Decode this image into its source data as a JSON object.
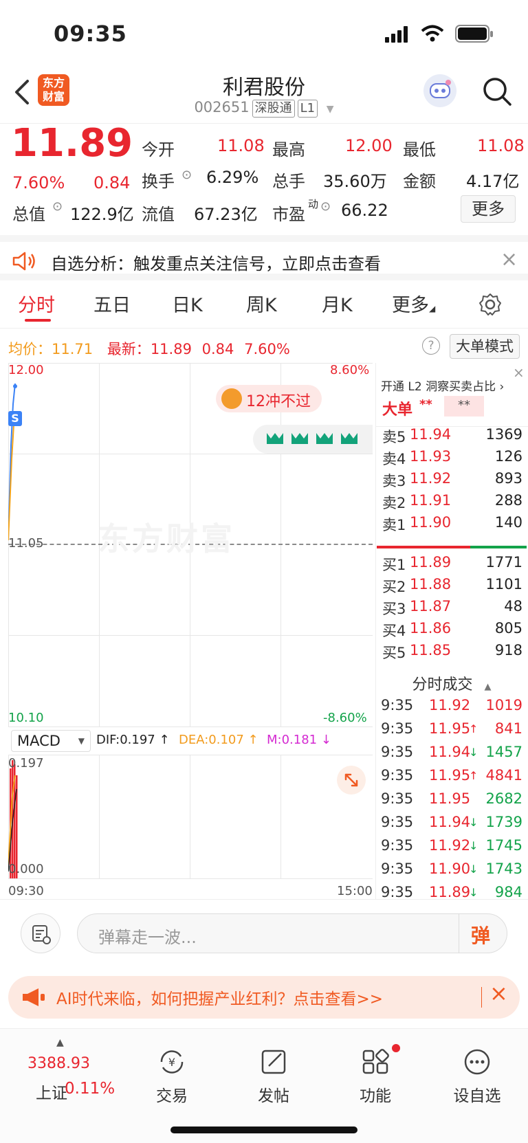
{
  "status_bar": {
    "time": "09:35"
  },
  "header": {
    "back_label": "<",
    "logo_text": "东方财富",
    "stock_name": "利君股份",
    "stock_code": "002651",
    "tag_market": "深股通",
    "tag_level": "L1"
  },
  "quote": {
    "price": "11.89",
    "change_pct": "7.60%",
    "change_abs": "0.84",
    "open_label": "今开",
    "open_value": "11.08",
    "high_label": "最高",
    "high_value": "12.00",
    "low_label": "最低",
    "low_value": "11.08",
    "turnover_label": "换手",
    "turnover_value": "6.29%",
    "volume_label": "总手",
    "volume_value": "35.60万",
    "amount_label": "金额",
    "amount_value": "4.17亿",
    "mktcap_label": "总值",
    "mktcap_value": "122.9亿",
    "float_label": "流值",
    "float_value": "67.23亿",
    "pe_label": "市盈",
    "pe_sup": "动",
    "pe_value": "66.22",
    "more_label": "更多"
  },
  "signal": {
    "text": "自选分析：触发重点关注信号，立即点击查看",
    "close": "×"
  },
  "tabs": [
    "分时",
    "五日",
    "日K",
    "周K",
    "月K",
    "更多"
  ],
  "price_line": {
    "avg_label": "均价：",
    "avg_value": "11.71",
    "latest_label": "最新：",
    "latest_value": "11.89",
    "latest_change": "0.84",
    "latest_pct": "7.60%",
    "help": "?",
    "mode_button": "大单模式"
  },
  "chart": {
    "y_top": "12.00",
    "y_top_pct": "8.60%",
    "y_mid": "11.05",
    "y_bottom": "10.10",
    "y_bottom_pct": "-8.60%",
    "badge_text": "12冲不过",
    "watermark": "东方财富",
    "s_marker": "S",
    "x_start": "09:30",
    "x_end": "15:00"
  },
  "macd": {
    "selector": "MACD",
    "dif_label": "DIF:0.197 ↑",
    "dea_label": "DEA:0.107 ↑",
    "m_label": "M:0.181 ↓",
    "y_top": "0.197",
    "y_bottom": "0.000"
  },
  "order_book": {
    "promo": "开通 L2 洞察买卖占比 ›",
    "big_label": "大单",
    "big_value": "**",
    "big_value2": "**",
    "asks": [
      {
        "label": "卖5",
        "price": "11.94",
        "vol": "1369"
      },
      {
        "label": "卖4",
        "price": "11.93",
        "vol": "126"
      },
      {
        "label": "卖3",
        "price": "11.92",
        "vol": "893"
      },
      {
        "label": "卖2",
        "price": "11.91",
        "vol": "288"
      },
      {
        "label": "卖1",
        "price": "11.90",
        "vol": "140"
      }
    ],
    "bids": [
      {
        "label": "买1",
        "price": "11.89",
        "vol": "1771"
      },
      {
        "label": "买2",
        "price": "11.88",
        "vol": "1101"
      },
      {
        "label": "买3",
        "price": "11.87",
        "vol": "48"
      },
      {
        "label": "买4",
        "price": "11.86",
        "vol": "805"
      },
      {
        "label": "买5",
        "price": "11.85",
        "vol": "918"
      }
    ],
    "trades_title": "分时成交",
    "trades": [
      {
        "time": "9:35",
        "price": "11.92",
        "arrow": "",
        "vol": "1019",
        "side": "red"
      },
      {
        "time": "9:35",
        "price": "11.95",
        "arrow": "↑",
        "vol": "841",
        "side": "red"
      },
      {
        "time": "9:35",
        "price": "11.94",
        "arrow": "↓",
        "vol": "1457",
        "side": "green"
      },
      {
        "time": "9:35",
        "price": "11.95",
        "arrow": "↑",
        "vol": "4841",
        "side": "red"
      },
      {
        "time": "9:35",
        "price": "11.95",
        "arrow": "",
        "vol": "2682",
        "side": "green"
      },
      {
        "time": "9:35",
        "price": "11.94",
        "arrow": "↓",
        "vol": "1739",
        "side": "green"
      },
      {
        "time": "9:35",
        "price": "11.92",
        "arrow": "↓",
        "vol": "1745",
        "side": "green"
      },
      {
        "time": "9:35",
        "price": "11.90",
        "arrow": "↓",
        "vol": "1743",
        "side": "green"
      },
      {
        "time": "9:35",
        "price": "11.89",
        "arrow": "↓",
        "vol": "984",
        "side": "green"
      }
    ]
  },
  "comment": {
    "placeholder": "弹幕走一波...",
    "send_label": "弹"
  },
  "ad": {
    "text": "AI时代来临，如何把握产业红利？点击查看>>",
    "close": "×"
  },
  "bottom_nav": {
    "index_value": "3388.93",
    "index_name": "上证",
    "index_pct": "0.11%",
    "items": [
      "交易",
      "发帖",
      "功能",
      "设自选"
    ]
  }
}
